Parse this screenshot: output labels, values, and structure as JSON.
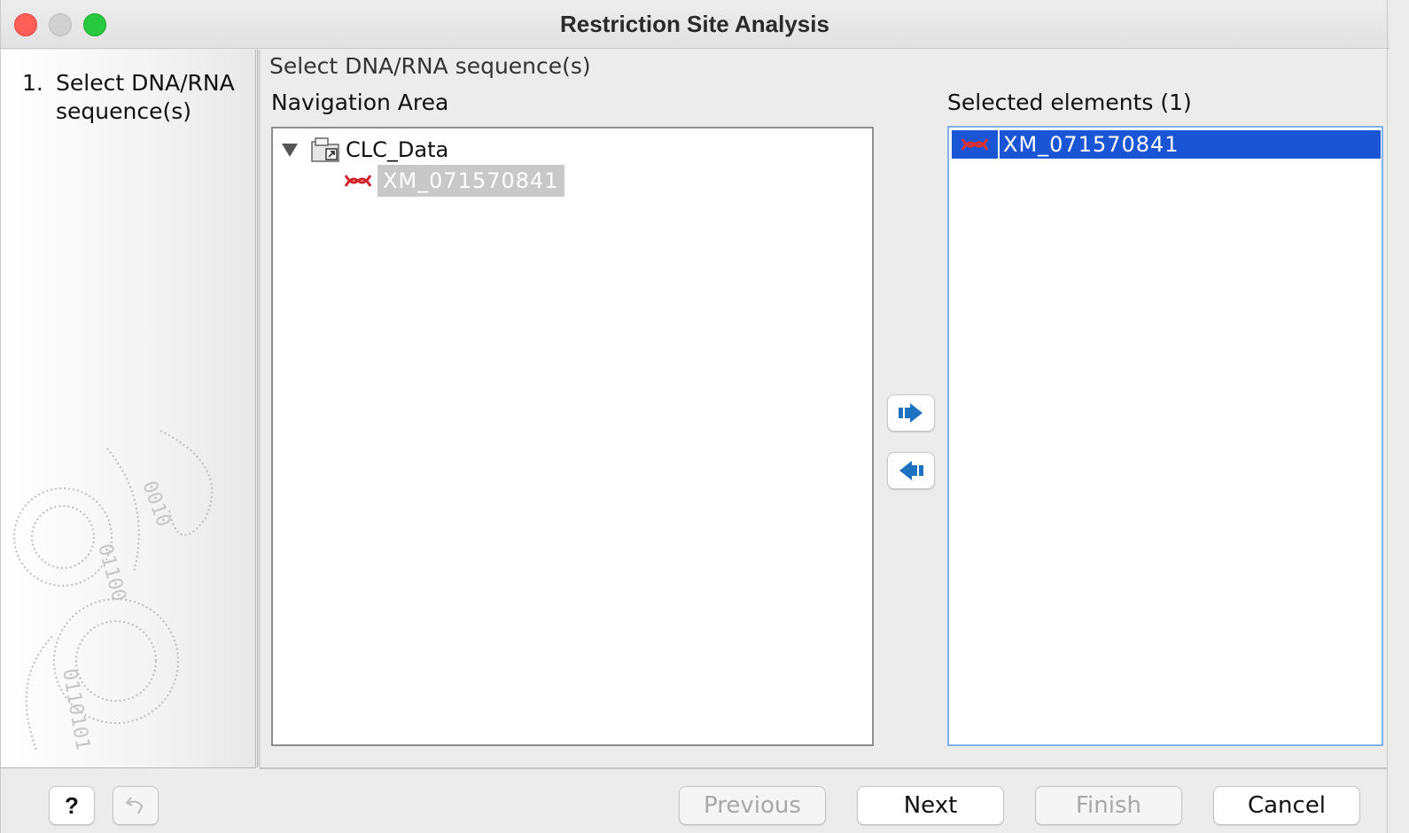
{
  "window": {
    "title": "Restriction Site Analysis"
  },
  "steps": [
    {
      "number": "1.",
      "label": "Select DNA/RNA sequence(s)"
    }
  ],
  "content": {
    "header": "Select DNA/RNA sequence(s)",
    "navigation_label": "Navigation Area",
    "selected_label": "Selected elements (1)",
    "tree": {
      "root": {
        "label": "CLC_Data",
        "icon": "folder-shortcut-icon",
        "expanded": true
      },
      "children": [
        {
          "label": "XM_071570841",
          "icon": "dna-sequence-icon"
        }
      ]
    },
    "selected_items": [
      {
        "label": "XM_071570841",
        "icon": "dna-sequence-icon"
      }
    ]
  },
  "buttons": {
    "help": "?",
    "previous": "Previous",
    "next": "Next",
    "finish": "Finish",
    "cancel": "Cancel"
  },
  "colors": {
    "selection": "#1a55d6",
    "selected_list_border": "#7fb0e8",
    "arrow_blue": "#1d73c2",
    "sequence_red": "#d2232a"
  }
}
